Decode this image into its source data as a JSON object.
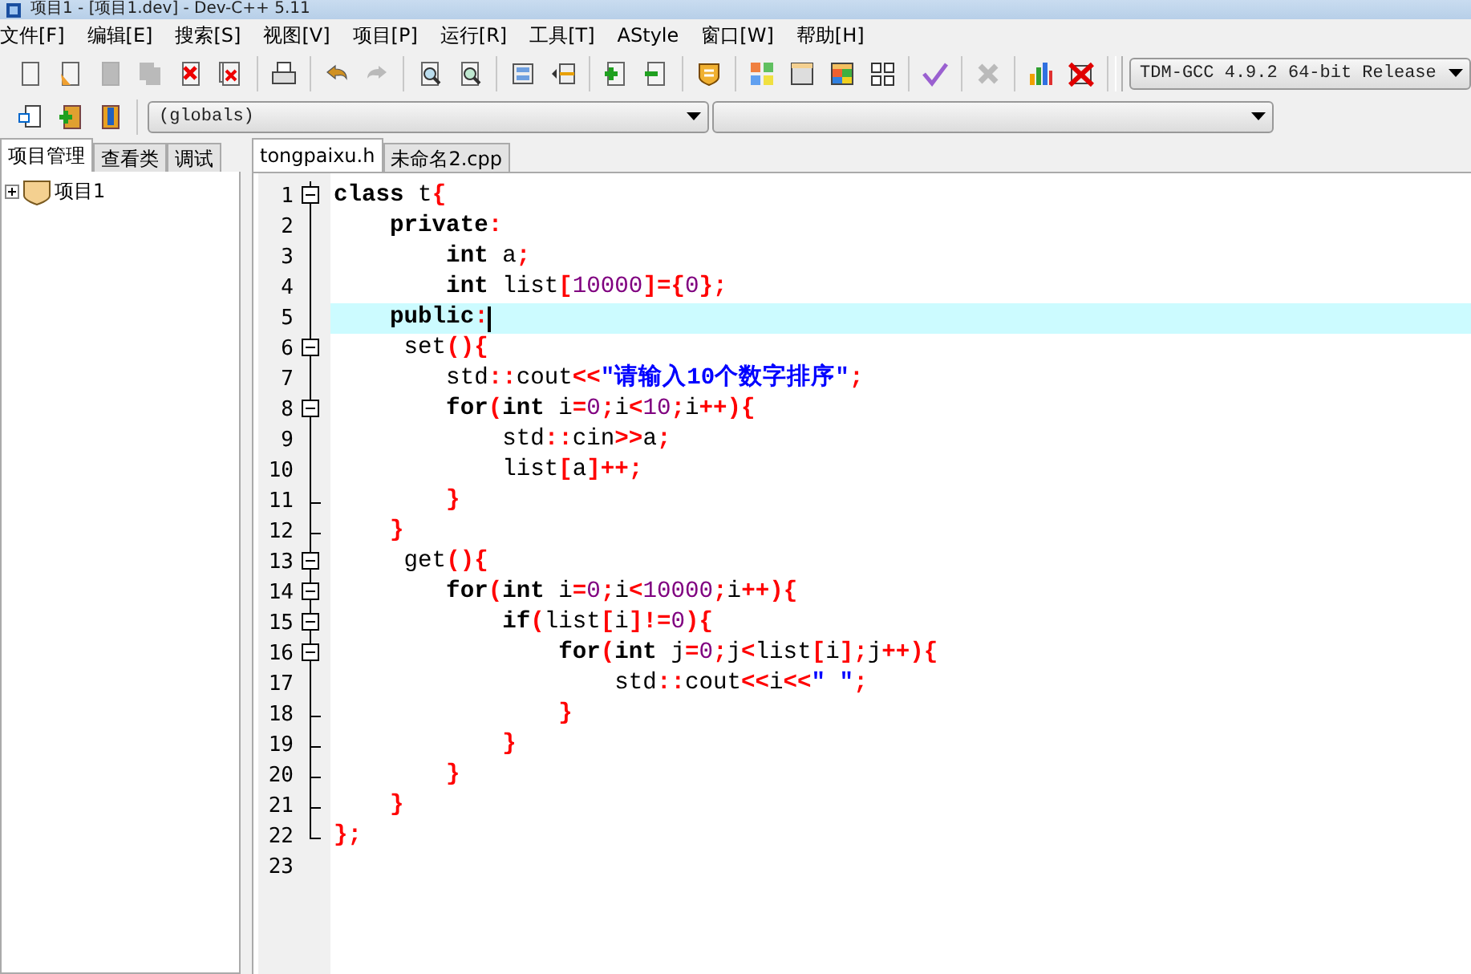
{
  "window": {
    "title": "项目1 - [项目1.dev] - Dev-C++ 5.11"
  },
  "menu": [
    "文件[F]",
    "编辑[E]",
    "搜索[S]",
    "视图[V]",
    "项目[P]",
    "运行[R]",
    "工具[T]",
    "AStyle",
    "窗口[W]",
    "帮助[H]"
  ],
  "toolbar": [
    [
      {
        "kind": "new",
        "disabled": false
      },
      {
        "kind": "open",
        "disabled": false
      },
      {
        "kind": "save",
        "disabled": true
      },
      {
        "kind": "saveall",
        "disabled": true
      },
      {
        "kind": "close",
        "disabled": false
      },
      {
        "kind": "closeall",
        "disabled": false
      }
    ],
    [
      {
        "kind": "print",
        "disabled": false
      }
    ],
    [
      {
        "kind": "undo",
        "disabled": false
      },
      {
        "kind": "redo",
        "disabled": true
      }
    ],
    [
      {
        "kind": "find",
        "disabled": false
      },
      {
        "kind": "replace",
        "disabled": false
      }
    ],
    [
      {
        "kind": "indent",
        "disabled": false
      },
      {
        "kind": "unindent",
        "disabled": false
      }
    ],
    [
      {
        "kind": "add",
        "disabled": false
      },
      {
        "kind": "remove",
        "disabled": false
      }
    ],
    [
      {
        "kind": "shield",
        "disabled": false
      }
    ],
    [
      {
        "kind": "grid",
        "disabled": false
      },
      {
        "kind": "window",
        "disabled": false
      },
      {
        "kind": "tile",
        "disabled": false
      },
      {
        "kind": "squares",
        "disabled": false
      }
    ],
    [
      {
        "kind": "check",
        "disabled": false
      }
    ],
    [
      {
        "kind": "stop",
        "disabled": true
      }
    ],
    [
      {
        "kind": "chart",
        "disabled": false
      },
      {
        "kind": "chartx",
        "disabled": false
      }
    ]
  ],
  "compiler": {
    "value": "TDM-GCC 4.9.2 64-bit Release"
  },
  "toolbar2": [
    {
      "kind": "class",
      "disabled": false
    },
    {
      "kind": "newclass",
      "disabled": false
    },
    {
      "kind": "book",
      "disabled": false
    }
  ],
  "scope": {
    "value": "(globals)"
  },
  "left_tabs": [
    {
      "label": "项目管理",
      "selected": true
    },
    {
      "label": "查看类",
      "selected": false
    },
    {
      "label": "调试",
      "selected": false
    }
  ],
  "tree": [
    {
      "label": "项目1",
      "expanded": false
    }
  ],
  "editor_tabs": [
    {
      "label": "tongpaixu.h",
      "selected": true
    },
    {
      "label": "未命名2.cpp",
      "selected": false
    }
  ],
  "lines": [
    {
      "number": "1",
      "kind": "fold_start",
      "highlighted": false,
      "tokens": [
        {
          "kind": "keyword",
          "text": "class"
        },
        {
          "kind": "ident",
          "text": " t"
        },
        {
          "kind": "symbol",
          "text": "{"
        }
      ]
    },
    {
      "number": "2",
      "kind": "fold_line",
      "highlighted": false,
      "tokens": [
        {
          "kind": "keyword",
          "text": "    private"
        },
        {
          "kind": "symbol",
          "text": ":"
        }
      ]
    },
    {
      "number": "3",
      "kind": "fold_line",
      "highlighted": false,
      "tokens": [
        {
          "kind": "keyword",
          "text": "        int"
        },
        {
          "kind": "ident",
          "text": " a"
        },
        {
          "kind": "symbol",
          "text": ";"
        }
      ]
    },
    {
      "number": "4",
      "kind": "fold_line",
      "highlighted": false,
      "tokens": [
        {
          "kind": "keyword",
          "text": "        int"
        },
        {
          "kind": "ident",
          "text": " list"
        },
        {
          "kind": "symbol",
          "text": "["
        },
        {
          "kind": "number",
          "text": "10000"
        },
        {
          "kind": "symbol",
          "text": "]={"
        },
        {
          "kind": "number",
          "text": "0"
        },
        {
          "kind": "symbol",
          "text": "};"
        }
      ]
    },
    {
      "number": "5",
      "kind": "fold_line",
      "highlighted": true,
      "tokens": [
        {
          "kind": "keyword",
          "text": "    public"
        },
        {
          "kind": "symbol",
          "text": ":"
        }
      ]
    },
    {
      "number": "6",
      "kind": "fold_start",
      "highlighted": false,
      "tokens": [
        {
          "kind": "ident",
          "text": "     set"
        },
        {
          "kind": "symbol",
          "text": "(){"
        }
      ]
    },
    {
      "number": "7",
      "kind": "fold_line",
      "highlighted": false,
      "tokens": [
        {
          "kind": "ident",
          "text": "        std"
        },
        {
          "kind": "symbol",
          "text": "::"
        },
        {
          "kind": "ident",
          "text": "cout"
        },
        {
          "kind": "symbol",
          "text": "<<"
        },
        {
          "kind": "string",
          "text": "\"请输入10个数字排序\""
        },
        {
          "kind": "symbol",
          "text": ";"
        }
      ]
    },
    {
      "number": "8",
      "kind": "fold_start",
      "highlighted": false,
      "tokens": [
        {
          "kind": "keyword",
          "text": "        for"
        },
        {
          "kind": "symbol",
          "text": "("
        },
        {
          "kind": "keyword",
          "text": "int"
        },
        {
          "kind": "ident",
          "text": " i"
        },
        {
          "kind": "symbol",
          "text": "="
        },
        {
          "kind": "number",
          "text": "0"
        },
        {
          "kind": "symbol",
          "text": ";"
        },
        {
          "kind": "ident",
          "text": "i"
        },
        {
          "kind": "symbol",
          "text": "<"
        },
        {
          "kind": "number",
          "text": "10"
        },
        {
          "kind": "symbol",
          "text": ";"
        },
        {
          "kind": "ident",
          "text": "i"
        },
        {
          "kind": "symbol",
          "text": "++){"
        }
      ]
    },
    {
      "number": "9",
      "kind": "fold_line",
      "highlighted": false,
      "tokens": [
        {
          "kind": "ident",
          "text": "            std"
        },
        {
          "kind": "symbol",
          "text": "::"
        },
        {
          "kind": "ident",
          "text": "cin"
        },
        {
          "kind": "symbol",
          "text": ">>"
        },
        {
          "kind": "ident",
          "text": "a"
        },
        {
          "kind": "symbol",
          "text": ";"
        }
      ]
    },
    {
      "number": "10",
      "kind": "fold_line",
      "highlighted": false,
      "tokens": [
        {
          "kind": "ident",
          "text": "            list"
        },
        {
          "kind": "symbol",
          "text": "["
        },
        {
          "kind": "ident",
          "text": "a"
        },
        {
          "kind": "symbol",
          "text": "]++;"
        }
      ]
    },
    {
      "number": "11",
      "kind": "fold_end",
      "highlighted": false,
      "tokens": [
        {
          "kind": "symbol",
          "text": "        }"
        }
      ]
    },
    {
      "number": "12",
      "kind": "fold_end",
      "highlighted": false,
      "tokens": [
        {
          "kind": "symbol",
          "text": "    }"
        }
      ]
    },
    {
      "number": "13",
      "kind": "fold_start",
      "highlighted": false,
      "tokens": [
        {
          "kind": "ident",
          "text": "     get"
        },
        {
          "kind": "symbol",
          "text": "(){"
        }
      ]
    },
    {
      "number": "14",
      "kind": "fold_start",
      "highlighted": false,
      "tokens": [
        {
          "kind": "keyword",
          "text": "        for"
        },
        {
          "kind": "symbol",
          "text": "("
        },
        {
          "kind": "keyword",
          "text": "int"
        },
        {
          "kind": "ident",
          "text": " i"
        },
        {
          "kind": "symbol",
          "text": "="
        },
        {
          "kind": "number",
          "text": "0"
        },
        {
          "kind": "symbol",
          "text": ";"
        },
        {
          "kind": "ident",
          "text": "i"
        },
        {
          "kind": "symbol",
          "text": "<"
        },
        {
          "kind": "number",
          "text": "10000"
        },
        {
          "kind": "symbol",
          "text": ";"
        },
        {
          "kind": "ident",
          "text": "i"
        },
        {
          "kind": "symbol",
          "text": "++){"
        }
      ]
    },
    {
      "number": "15",
      "kind": "fold_start",
      "highlighted": false,
      "tokens": [
        {
          "kind": "keyword",
          "text": "            if"
        },
        {
          "kind": "symbol",
          "text": "("
        },
        {
          "kind": "ident",
          "text": "list"
        },
        {
          "kind": "symbol",
          "text": "["
        },
        {
          "kind": "ident",
          "text": "i"
        },
        {
          "kind": "symbol",
          "text": "]!="
        },
        {
          "kind": "number",
          "text": "0"
        },
        {
          "kind": "symbol",
          "text": "){"
        }
      ]
    },
    {
      "number": "16",
      "kind": "fold_start",
      "highlighted": false,
      "tokens": [
        {
          "kind": "keyword",
          "text": "                for"
        },
        {
          "kind": "symbol",
          "text": "("
        },
        {
          "kind": "keyword",
          "text": "int"
        },
        {
          "kind": "ident",
          "text": " j"
        },
        {
          "kind": "symbol",
          "text": "="
        },
        {
          "kind": "number",
          "text": "0"
        },
        {
          "kind": "symbol",
          "text": ";"
        },
        {
          "kind": "ident",
          "text": "j"
        },
        {
          "kind": "symbol",
          "text": "<"
        },
        {
          "kind": "ident",
          "text": "list"
        },
        {
          "kind": "symbol",
          "text": "["
        },
        {
          "kind": "ident",
          "text": "i"
        },
        {
          "kind": "symbol",
          "text": "];"
        },
        {
          "kind": "ident",
          "text": "j"
        },
        {
          "kind": "symbol",
          "text": "++){"
        }
      ]
    },
    {
      "number": "17",
      "kind": "fold_line",
      "highlighted": false,
      "tokens": [
        {
          "kind": "ident",
          "text": "                    std"
        },
        {
          "kind": "symbol",
          "text": "::"
        },
        {
          "kind": "ident",
          "text": "cout"
        },
        {
          "kind": "symbol",
          "text": "<<"
        },
        {
          "kind": "ident",
          "text": "i"
        },
        {
          "kind": "symbol",
          "text": "<<"
        },
        {
          "kind": "string",
          "text": "\" \""
        },
        {
          "kind": "symbol",
          "text": ";"
        }
      ]
    },
    {
      "number": "18",
      "kind": "fold_end",
      "highlighted": false,
      "tokens": [
        {
          "kind": "symbol",
          "text": "                }"
        }
      ]
    },
    {
      "number": "19",
      "kind": "fold_end",
      "highlighted": false,
      "tokens": [
        {
          "kind": "symbol",
          "text": "            }"
        }
      ]
    },
    {
      "number": "20",
      "kind": "fold_end",
      "highlighted": false,
      "tokens": [
        {
          "kind": "symbol",
          "text": "        }"
        }
      ]
    },
    {
      "number": "21",
      "kind": "fold_end",
      "highlighted": false,
      "tokens": [
        {
          "kind": "symbol",
          "text": "    }"
        }
      ]
    },
    {
      "number": "22",
      "kind": "fold_last",
      "highlighted": false,
      "tokens": [
        {
          "kind": "symbol",
          "text": "};"
        }
      ]
    },
    {
      "number": "23",
      "kind": "plain",
      "highlighted": false
    }
  ]
}
